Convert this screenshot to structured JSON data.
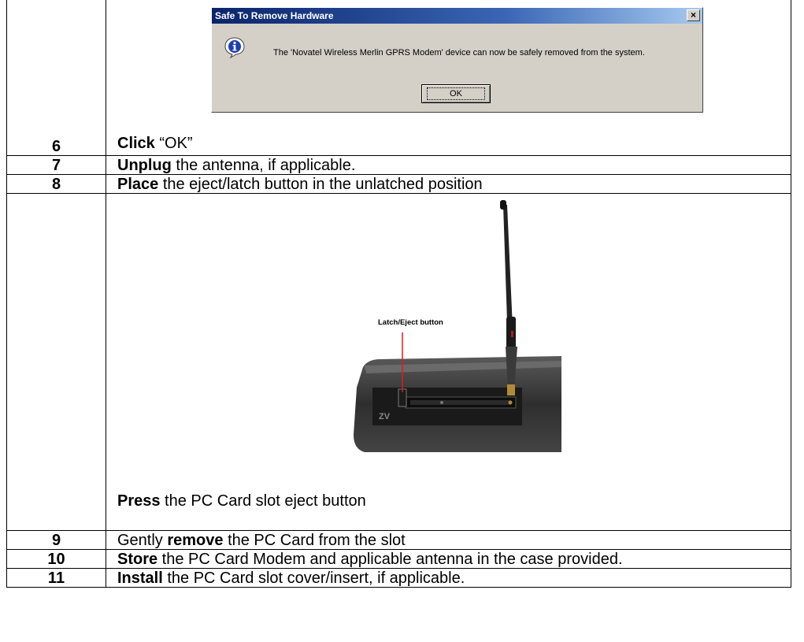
{
  "dialog": {
    "title": "Safe To Remove Hardware",
    "close_glyph": "×",
    "message": "The 'Novatel Wireless Merlin GPRS Modem' device can now be safely removed from the system.",
    "ok_label": "OK",
    "icon": "info-icon"
  },
  "photo": {
    "callout_label": "Latch/Eject button",
    "case_mark": "ZV"
  },
  "steps": [
    {
      "num": "6",
      "bold": "Click ",
      "text": "“OK”"
    },
    {
      "num": "7",
      "bold": "Unplug",
      "text": " the antenna, if applicable."
    },
    {
      "num": "8",
      "bold": "Place",
      "text": " the eject/latch button in the unlatched position"
    },
    {
      "num": "",
      "bold": "Press",
      "text": " the PC Card slot eject button"
    },
    {
      "num": "9",
      "pre": "Gently ",
      "bold": "remove",
      "text": " the PC Card from the slot"
    },
    {
      "num": "10",
      "bold": "Store",
      "text": " the PC Card Modem and applicable antenna in the case provided."
    },
    {
      "num": "11",
      "bold": "Install",
      "text": " the PC Card slot cover/insert, if applicable."
    }
  ],
  "colors": {
    "dialog_face": "#d4d0c8",
    "titlebar_start": "#0a246a",
    "callout_line": "#e41b1b"
  }
}
